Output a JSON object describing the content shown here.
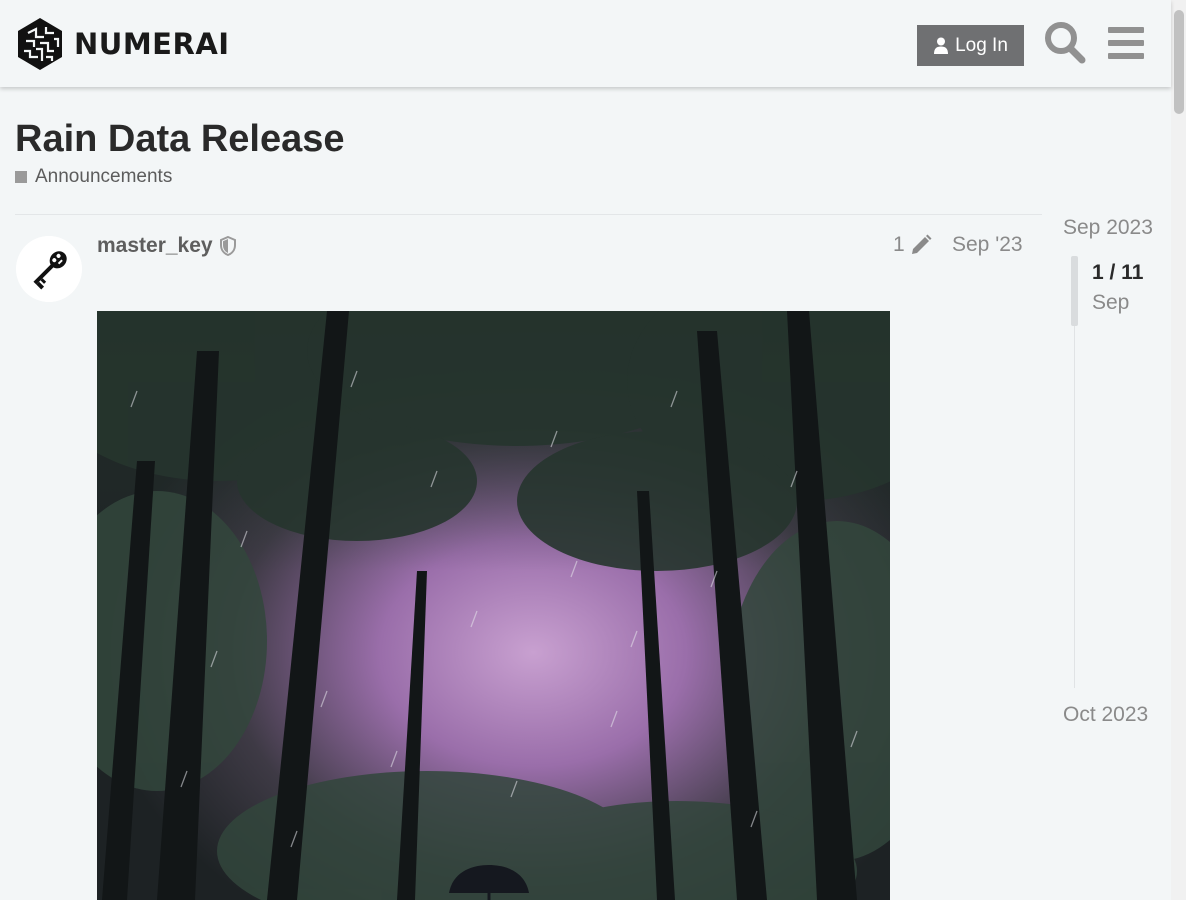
{
  "header": {
    "logo_text": "NUMERAI",
    "login_label": "Log In",
    "search_icon": "search-icon",
    "menu_icon": "hamburger-menu-icon"
  },
  "topic": {
    "title": "Rain Data Release",
    "category": "Announcements",
    "category_color": "#9a9a9a"
  },
  "post": {
    "username": "master_key",
    "edit_count": "1",
    "date": "Sep '23",
    "image_alt": "forest in purple rain with umbrella"
  },
  "timeline": {
    "start_date": "Sep 2023",
    "position": "1 / 11",
    "current_month": "Sep",
    "end_date": "Oct 2023"
  },
  "colors": {
    "background": "#f3f6f7",
    "button": "#6f7072"
  }
}
